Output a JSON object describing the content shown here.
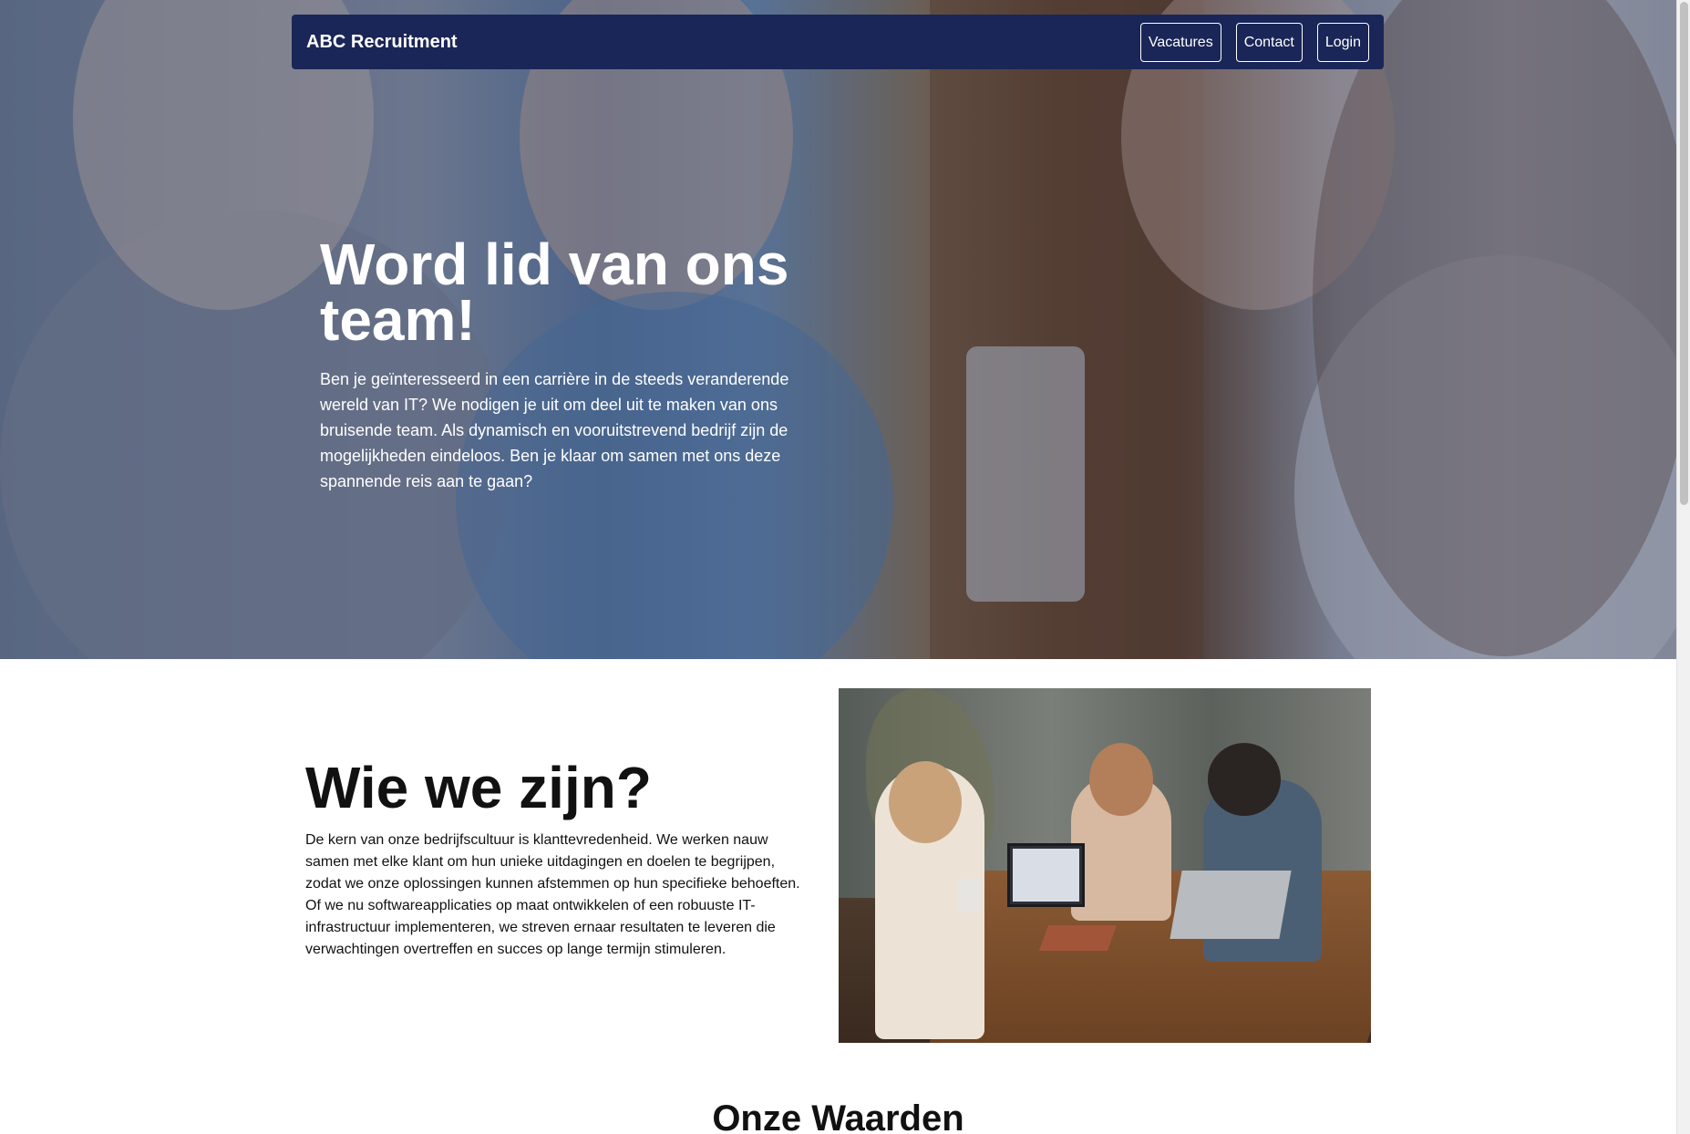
{
  "navbar": {
    "brand": "ABC Recruitment",
    "links": [
      "Vacatures",
      "Contact",
      "Login"
    ]
  },
  "hero": {
    "title": "Word lid van ons team!",
    "description": "Ben je geïnteresseerd in een carrière in de steeds veranderende wereld van IT? We nodigen je uit om deel uit te maken van ons bruisende team. Als dynamisch en vooruitstrevend bedrijf zijn de mogelijkheden eindeloos. Ben je klaar om samen met ons deze spannende reis aan te gaan?"
  },
  "about": {
    "title": "Wie we zijn?",
    "description": "De kern van onze bedrijfscultuur is klanttevredenheid. We werken nauw samen met elke klant om hun unieke uitdagingen en doelen te begrijpen, zodat we onze oplossingen kunnen afstemmen op hun specifieke behoeften. Of we nu softwareapplicaties op maat ontwikkelen of een robuuste IT-infrastructuur implementeren, we streven ernaar resultaten te leveren die verwachtingen overtreffen en succes op lange termijn stimuleren."
  },
  "values": {
    "title": "Onze Waarden"
  },
  "colors": {
    "navbar_bg": "#1a2657",
    "text_light": "#ffffff",
    "text_dark": "#111111"
  }
}
